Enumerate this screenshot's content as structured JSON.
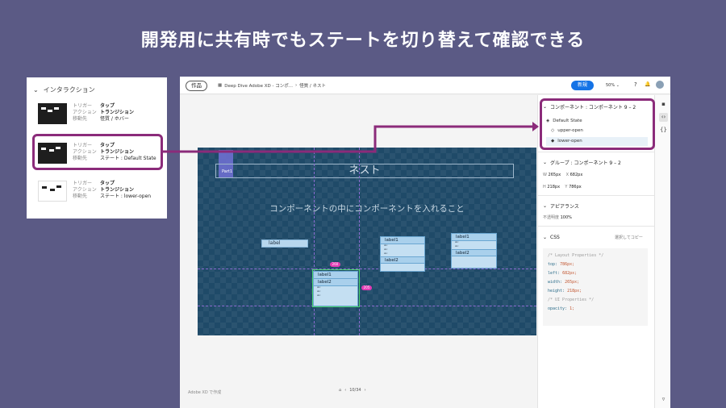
{
  "slide": {
    "title": "開発用に共有時でもステートを切り替えて確認できる"
  },
  "interaction_panel": {
    "heading": "インタラクション",
    "labels": [
      "トリガー",
      "アクション",
      "移動先"
    ],
    "items": [
      {
        "trigger": "タップ",
        "action": "トランジション",
        "destination": "怪質 / ホバー"
      },
      {
        "trigger": "タップ",
        "action": "トランジション",
        "destination": "ステート : Default State"
      },
      {
        "trigger": "タップ",
        "action": "トランジション",
        "destination": "ステート : lower-open"
      }
    ]
  },
  "toolbar": {
    "home": "作品",
    "breadcrumb": [
      "Deep Dive Adobe XD - コンポ...",
      "怪質 / ネスト"
    ],
    "share": "新規",
    "zoom": "50%",
    "help": "?",
    "bell": "🔔"
  },
  "artboard": {
    "title": "ネスト",
    "tab_label": "Part1",
    "subtitle": "コンポーネントの中にコンポーネントを入れること",
    "label_single": "label",
    "dd1": {
      "row1": "label1",
      "row2": "label2"
    },
    "dd2": {
      "row1": "label1",
      "row2": "label2"
    },
    "dd3": {
      "row1": "label1",
      "row2": "label2"
    },
    "badge_top": "260",
    "badge_right": "205"
  },
  "canvas_footer": {
    "made_with": "Adobe XD で作成",
    "page": "10/34"
  },
  "inspector": {
    "component_title": "コンポーネント : コンポーネント 9 – 2",
    "default_state": "Default State",
    "states": [
      "upper-open",
      "lower-open"
    ],
    "group_title": "グループ : コンポーネント 9 – 2",
    "w_label": "W",
    "w_value": "265px",
    "x_label": "X",
    "x_value": "682px",
    "h_label": "H",
    "h_value": "218px",
    "y_label": "Y",
    "y_value": "786px",
    "appearance_title": "アピアランス",
    "opacity_label": "不透明度",
    "opacity_value": "100%",
    "css_title": "CSS",
    "css_copy": "選択してコピー",
    "css_lines": {
      "c1": "/* Layout Properties */",
      "top_k": "top:",
      "top_v": "786px;",
      "left_k": "left:",
      "left_v": "682px;",
      "width_k": "width:",
      "width_v": "265px;",
      "height_k": "height:",
      "height_v": "218px;",
      "c2": "/* UI Properties */",
      "op_k": "opacity:",
      "op_v": "1;"
    }
  },
  "colors": {
    "accent": "#8b2b7a",
    "share": "#1473e6",
    "slide_bg": "#5b5a85",
    "artboard": "#1f4a68"
  }
}
